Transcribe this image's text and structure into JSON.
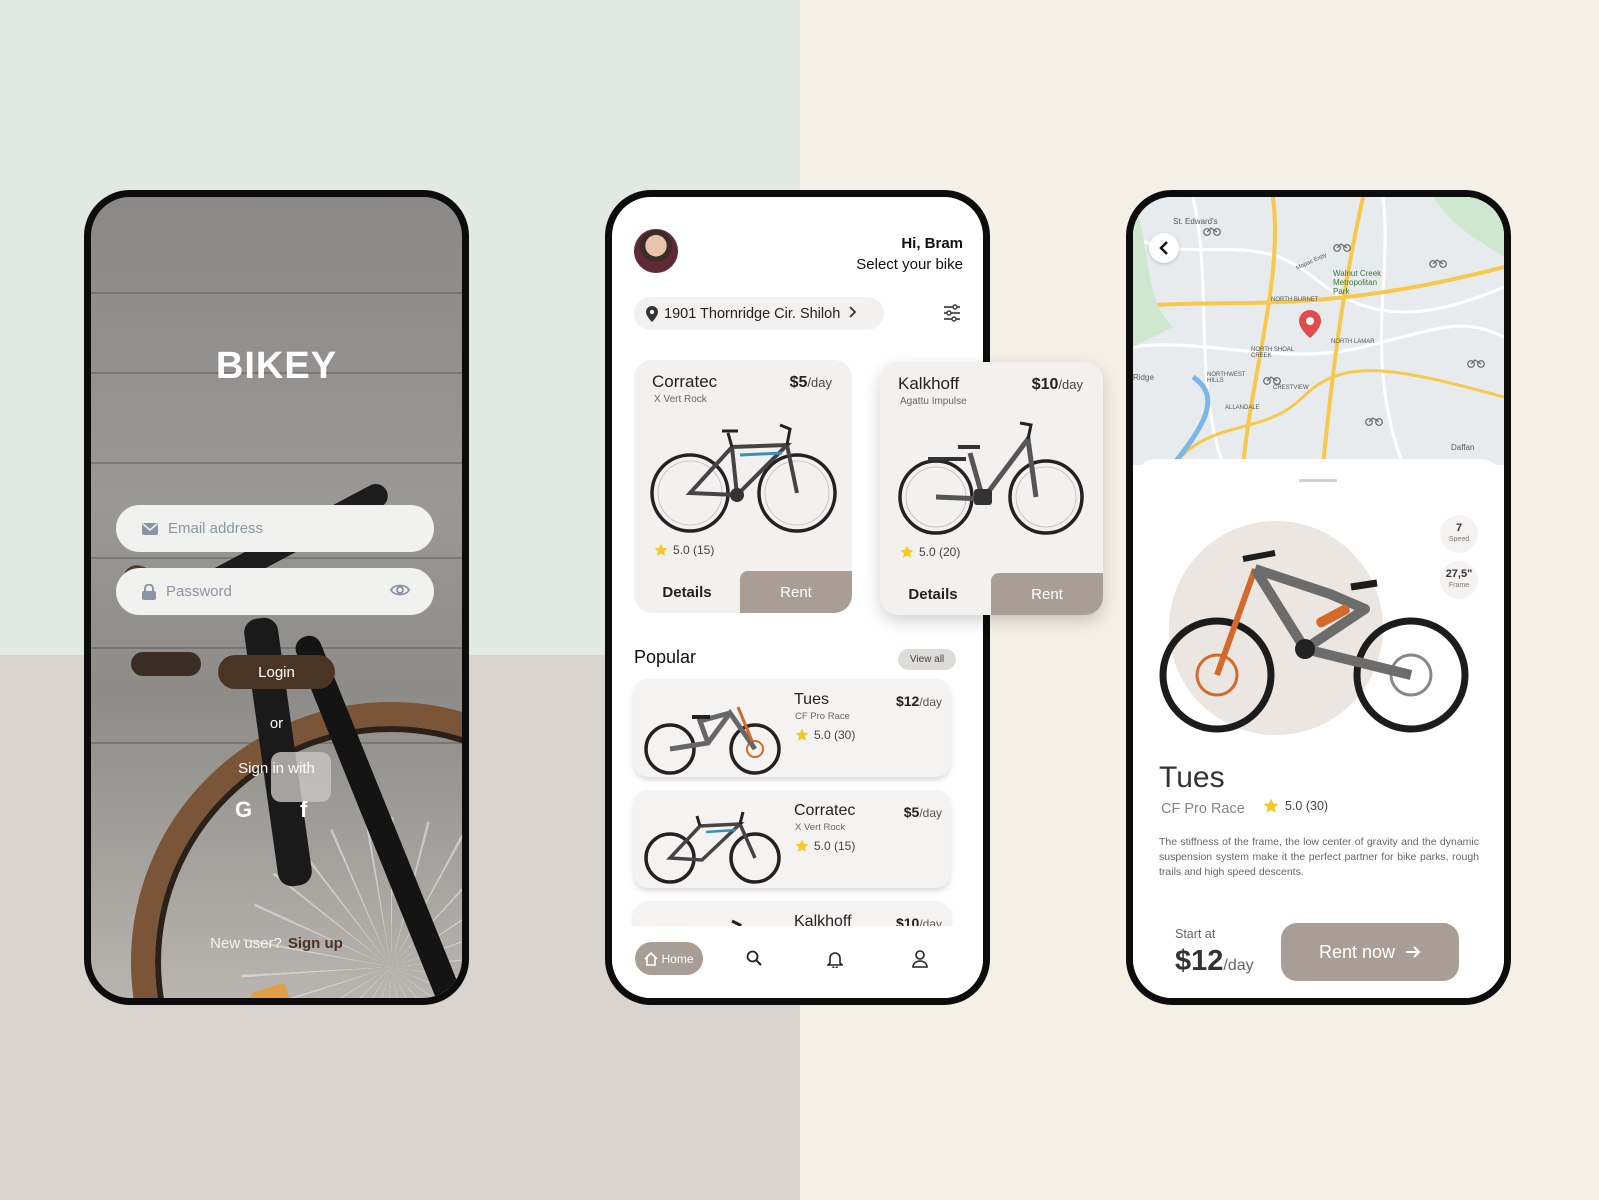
{
  "colors": {
    "accent": "#a89e95",
    "dark_brown": "#4a3424",
    "bg_mint": "#e1e9e3",
    "bg_taupe": "#d9d4ce",
    "bg_cream": "#f4f0e6",
    "star": "#f2c925"
  },
  "login": {
    "brand": "BIKEY",
    "email_placeholder": "Email address",
    "password_placeholder": "Password",
    "login_label": "Login",
    "or_text": "or",
    "sign_in_with": "Sign in with",
    "google_label": "G",
    "facebook_label": "f",
    "new_user_text": "New user?",
    "sign_up_label": "Sign up"
  },
  "home": {
    "greeting": "Hi, Bram",
    "subtitle": "Select your bike",
    "location": "1901 Thornridge Cir. Shiloh",
    "featured": [
      {
        "name": "Corratec",
        "model": "X Vert Rock",
        "price": "$5",
        "unit": "/day",
        "rating": "5.0 (15)",
        "details_label": "Details",
        "rent_label": "Rent"
      },
      {
        "name": "Kalkhoff",
        "model": "Agattu Impulse",
        "price": "$10",
        "unit": "/day",
        "rating": "5.0 (20)",
        "details_label": "Details",
        "rent_label": "Rent"
      }
    ],
    "popular_title": "Popular",
    "view_all_label": "View all",
    "popular": [
      {
        "name": "Tues",
        "model": "CF Pro Race",
        "price": "$12",
        "unit": "/day",
        "rating": "5.0 (30)"
      },
      {
        "name": "Corratec",
        "model": "X Vert Rock",
        "price": "$5",
        "unit": "/day",
        "rating": "5.0 (15)"
      },
      {
        "name": "Kalkhoff",
        "price": "$10",
        "unit": "/day"
      }
    ],
    "nav": {
      "home_label": "Home"
    }
  },
  "detail": {
    "map_labels": [
      "St. Edward's",
      "Walnut Creek Metropolitan Park",
      "NORTH BURNET",
      "NORTH LAMAR",
      "NORTH SHOAL CREEK",
      "NORTHWEST HILLS",
      "CRESTVIEW",
      "ALLANDALE",
      "Daffan",
      "Mopac Expy",
      "Ridge"
    ],
    "specs": [
      {
        "value": "7",
        "label": "Speed"
      },
      {
        "value": "27,5\"",
        "label": "Frame"
      }
    ],
    "name": "Tues",
    "model": "CF Pro Race",
    "rating": "5.0 (30)",
    "description": "The stiffness of the frame, the low center of gravity and the dynamic suspension system make it the perfect partner for bike parks, rough trails and high speed descents.",
    "start_at_label": "Start at",
    "price": "$12",
    "unit": "/day",
    "rent_now_label": "Rent now"
  }
}
